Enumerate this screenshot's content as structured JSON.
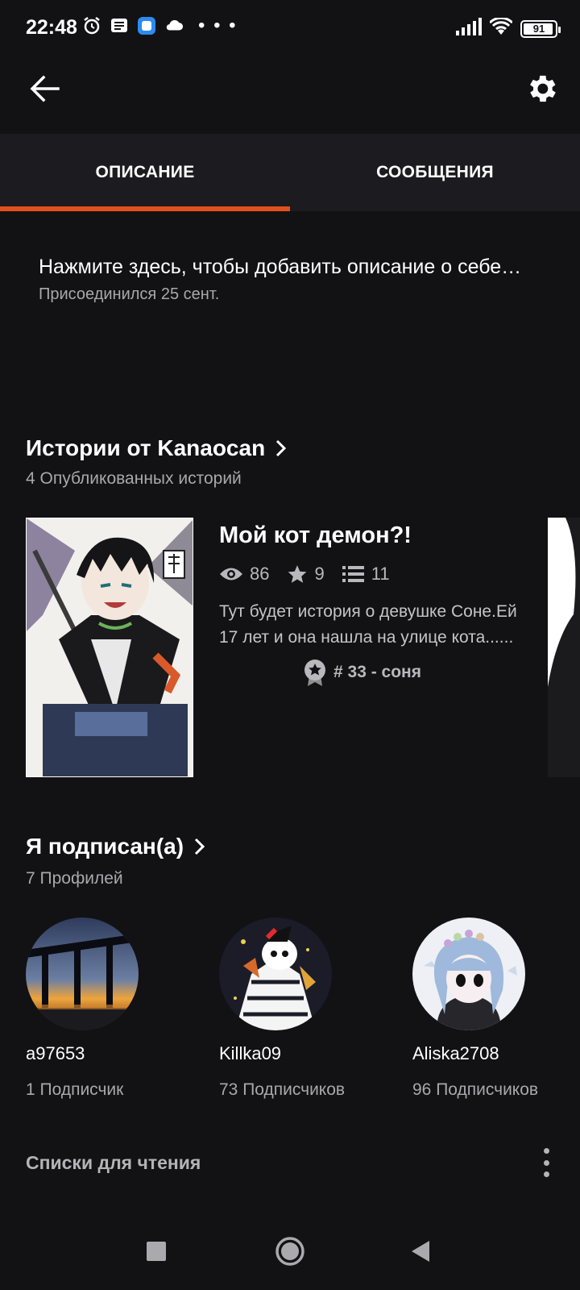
{
  "status_bar": {
    "time": "22:48",
    "left_icons": [
      "alarm-icon",
      "message-icon",
      "app-icon",
      "cloud-icon"
    ],
    "more": "• • •",
    "battery": "91"
  },
  "toolbar": {
    "back_icon": "arrow-left-icon",
    "settings_icon": "gear-icon"
  },
  "tabs": [
    {
      "label": "ОПИСАНИЕ",
      "active": true
    },
    {
      "label": "СООБЩЕНИЯ",
      "active": false
    }
  ],
  "colors": {
    "accent": "#e3501d",
    "background": "#121114",
    "tabbar": "#1c1b1f"
  },
  "description": {
    "text": "Нажмите здесь, чтобы добавить описание о себе…",
    "joined": "Присоединился 25 сент."
  },
  "stories": {
    "title": "Истории от Kanaocan",
    "subtitle": "4 Опубликованных историй",
    "items": [
      {
        "title": "Мой кот демон?!",
        "views": "86",
        "votes": "9",
        "parts": "11",
        "description": "Тут будет история о девушке Соне.Ей 17 лет и она нашла на улице кота......",
        "rank": "# 33 - соня"
      }
    ]
  },
  "following": {
    "title": "Я подписан(а)",
    "subtitle": "7 Профилей",
    "profiles": [
      {
        "name": "a97653",
        "followers": "1 Подписчик"
      },
      {
        "name": "Killka09",
        "followers": "73 Подписчиков"
      },
      {
        "name": "Aliska2708",
        "followers": "96 Подписчиков"
      }
    ]
  },
  "reading_lists": {
    "title": "Списки для чтения"
  },
  "navbar": {
    "icons": [
      "recents-square-icon",
      "home-circle-icon",
      "back-triangle-icon"
    ]
  }
}
